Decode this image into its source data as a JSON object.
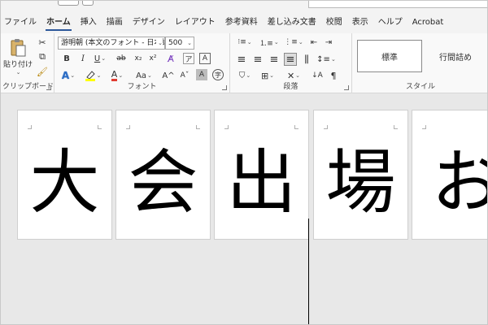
{
  "tabs": [
    "ファイル",
    "ホーム",
    "挿入",
    "描画",
    "デザイン",
    "レイアウト",
    "参考資料",
    "差し込み文書",
    "校閲",
    "表示",
    "ヘルプ",
    "Acrobat"
  ],
  "active_tab": "ホーム",
  "clipboard": {
    "paste_label": "貼り付け",
    "group_label": "クリップボード"
  },
  "font": {
    "font_name": "游明朝 (本文のフォント - 日本語)",
    "font_size": "500",
    "group_label": "フォント",
    "bold": "B",
    "italic": "I",
    "underline": "U",
    "strike": "ab",
    "subscript": "x₂",
    "superscript": "x²",
    "text_effect": "A",
    "change_case": "Aa",
    "grow": "A^",
    "shrink": "Aˇ",
    "char_border": "A",
    "char_shade": "A",
    "enclose": "字"
  },
  "paragraph": {
    "group_label": "段落"
  },
  "styles": {
    "items": [
      "標準",
      "行間詰め"
    ],
    "group_label": "スタイル"
  },
  "pages": [
    "大",
    "会",
    "出",
    "場",
    "お"
  ],
  "colors": {
    "accent": "#2b579a",
    "highlight": "#ffff00",
    "font_color": "#e03c31"
  }
}
